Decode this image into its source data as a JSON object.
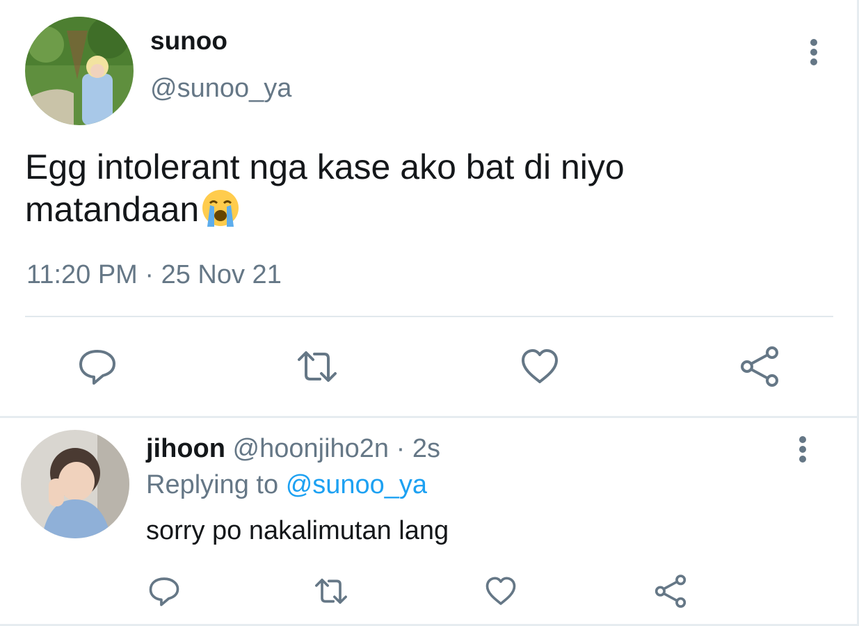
{
  "main_tweet": {
    "author_name": "sunoo",
    "author_handle": "@sunoo_ya",
    "text": "Egg intolerant nga kase ako bat di niyo matandaan",
    "emoji": "loudly-crying-face-icon",
    "timestamp": "11:20 PM · 25 Nov 21",
    "actions": [
      "reply-icon",
      "retweet-icon",
      "like-icon",
      "share-icon"
    ]
  },
  "reply_tweet": {
    "author_name": "jihoon",
    "author_meta": "@hoonjiho2n · 2s",
    "replying_prefix": "Replying to",
    "replying_handle": "@sunoo_ya",
    "text": "sorry po nakalimutan lang",
    "actions": [
      "reply-icon",
      "retweet-icon",
      "like-icon",
      "share-icon"
    ]
  },
  "colors": {
    "text_primary": "#14171a",
    "text_secondary": "#657786",
    "accent": "#1da1f2",
    "icon": "#657786",
    "divider": "#e1e8ed"
  }
}
